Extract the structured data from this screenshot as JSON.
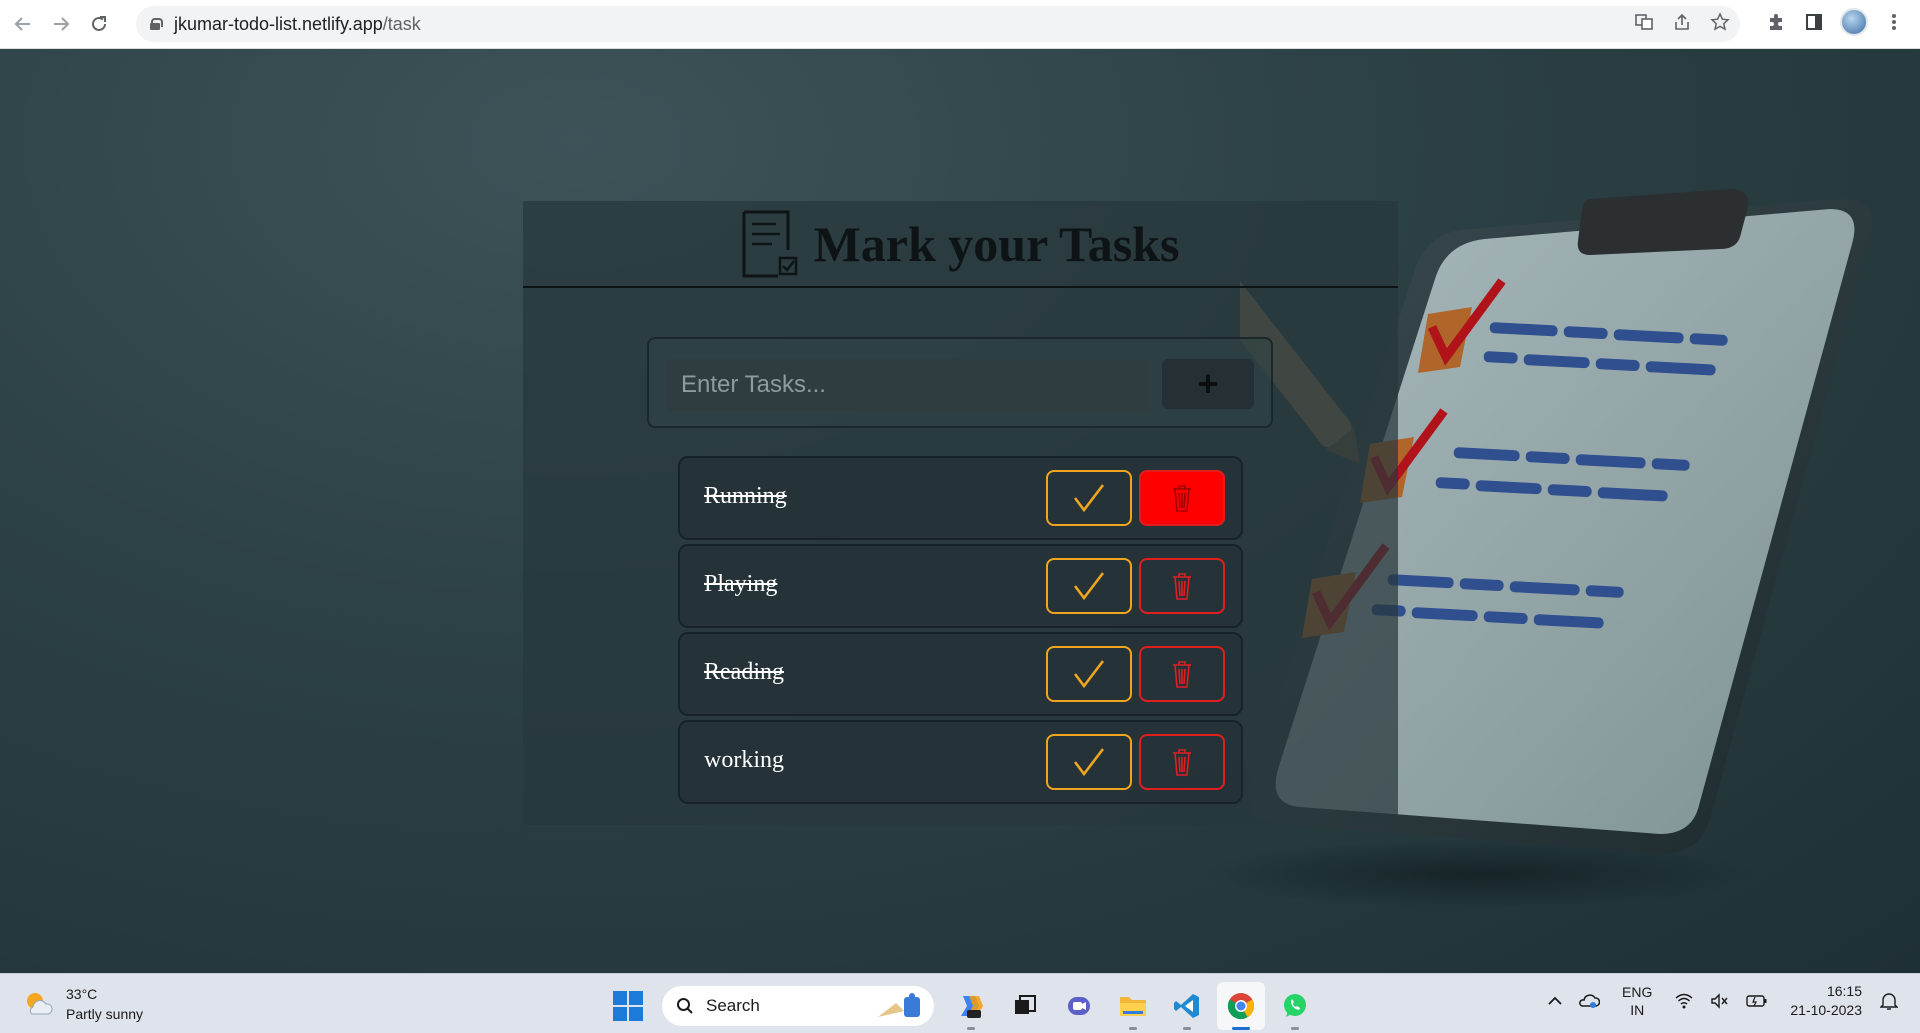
{
  "browser": {
    "url_host": "jkumar-todo-list.netlify.app",
    "url_path": "/task"
  },
  "app": {
    "title": "Mark your Tasks",
    "input": {
      "placeholder": "Enter Tasks...",
      "value": ""
    },
    "add_label": "+",
    "tasks": [
      {
        "label": "Running",
        "done": true
      },
      {
        "label": "Playing",
        "done": true
      },
      {
        "label": "Reading",
        "done": true
      },
      {
        "label": "working",
        "done": false
      }
    ]
  },
  "taskbar": {
    "weather": {
      "temp": "33°C",
      "desc": "Partly sunny"
    },
    "search_label": "Search",
    "language": {
      "line1": "ENG",
      "line2": "IN"
    },
    "clock": {
      "time": "16:15",
      "date": "21-10-2023"
    }
  },
  "colors": {
    "check_accent": "#f0a51e",
    "delete_accent": "#e01e1e",
    "delete_active_fill": "#ff0000"
  }
}
